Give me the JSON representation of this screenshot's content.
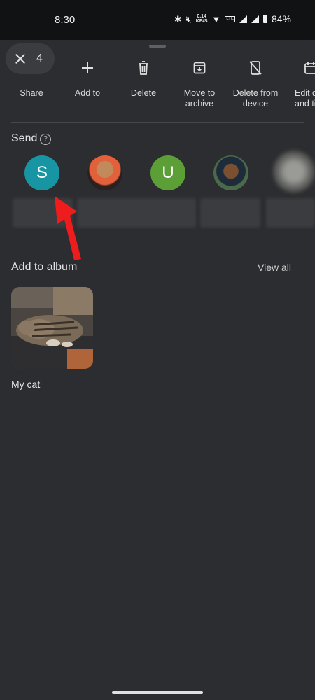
{
  "status": {
    "time": "8:30",
    "net_speed_value": "0.14",
    "net_speed_unit": "KB/S",
    "battery": "84%"
  },
  "selection": {
    "count": "4"
  },
  "actions": [
    {
      "label": "Share",
      "icon": "share-icon"
    },
    {
      "label": "Add to",
      "icon": "plus-icon"
    },
    {
      "label": "Delete",
      "icon": "trash-icon"
    },
    {
      "label": "Move to\narchive",
      "icon": "archive-icon"
    },
    {
      "label": "Delete from\ndevice",
      "icon": "delete-from-device-icon"
    },
    {
      "label": "Edit d\nand ti",
      "icon": "calendar-edit-icon"
    }
  ],
  "send": {
    "title": "Send",
    "contacts": [
      {
        "initial": "S",
        "color": "#1795a2"
      },
      {
        "initial": "",
        "color": "#3a2a2a"
      },
      {
        "initial": "U",
        "color": "#5c9f37"
      },
      {
        "initial": "",
        "color": "#3a4a3a"
      },
      {
        "initial": "",
        "color": "#6a6a68"
      }
    ]
  },
  "album": {
    "title": "Add to album",
    "view_all": "View all",
    "items": [
      {
        "name": "My cat"
      }
    ]
  },
  "colors": {
    "background": "#2c2d30",
    "annotation_arrow": "#ee1c1c"
  }
}
